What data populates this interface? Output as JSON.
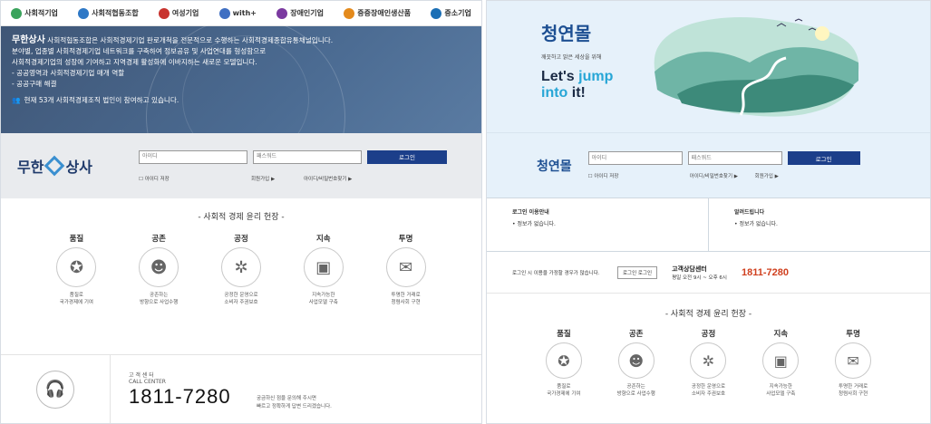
{
  "left": {
    "partners": [
      {
        "label": "사회적기업",
        "color": "#3aa35c"
      },
      {
        "label": "사회적협동조합",
        "color": "#2e78c6"
      },
      {
        "label": "여성기업",
        "color": "#c8332e"
      },
      {
        "label": "with+",
        "color": "#3f6fc2"
      },
      {
        "label": "장애인기업",
        "color": "#7b3aa0"
      },
      {
        "label": "중증장애인생산품",
        "color": "#e48a1c"
      },
      {
        "label": "중소기업",
        "color": "#1b6fb5"
      }
    ],
    "hero": {
      "title": "무한상사",
      "lines": [
        "사회적협동조합은 사회적경제기업 판로개척을 전문적으로 수행하는 사회적경제종합유통채널입니다.",
        "분야별, 업종별 사회적경제기업 네트워크를 구축하여 정보공유 및 사업연대를 형성함으로",
        "사회적경제기업의 성장에 기여하고 지역경제 활성화에 이바지하는 새로운 모델입니다.",
        "- 공공영역과 사회적경제기업 매개 역할",
        "- 공공구매 해결"
      ],
      "notice": "현재 53개 사회적경제조직 법인이 참여하고 있습니다."
    },
    "login": {
      "brand_a": "무한",
      "brand_b": "상사",
      "id_placeholder": "아이디",
      "pw_placeholder": "패스워드",
      "button": "로그인",
      "remember": "아이디 저장",
      "join": "회원가입 ▶",
      "find": "아이디/비밀번호찾기 ▶"
    },
    "ethics_title": "- 사회적 경제 윤리 헌장 -",
    "ethics": [
      {
        "name": "품질",
        "desc1": "품질로",
        "desc2": "국가경제에 기여",
        "icon": "medal-icon",
        "glyph": "✪"
      },
      {
        "name": "공존",
        "desc1": "공존하는",
        "desc2": "방향으로 사업수행",
        "icon": "people-icon",
        "glyph": "☻"
      },
      {
        "name": "공정",
        "desc1": "공정한 운영으로",
        "desc2": "소비자 주권보호",
        "icon": "network-icon",
        "glyph": "✲"
      },
      {
        "name": "지속",
        "desc1": "지속가능한",
        "desc2": "사업모델 구축",
        "icon": "box-icon",
        "glyph": "▣"
      },
      {
        "name": "투명",
        "desc1": "투명한 거래로",
        "desc2": "청렴사회 구현",
        "icon": "chat-icon",
        "glyph": "✉"
      }
    ],
    "call": {
      "label_ko": "고 객 센 터",
      "label_en": "CALL CENTER",
      "number": "1811-7280",
      "note1": "궁금하신 점을 문의해 주시면",
      "note2": "빠르고 정확하게 답변 드리겠습니다."
    }
  },
  "right": {
    "logo": "청연몰",
    "sub": "깨끗하고 맑은 세상을 위해",
    "slogan_a": "Let's ",
    "slogan_b": "jump",
    "slogan_c": "into",
    "slogan_d": " it!",
    "login": {
      "logo": "청연몰",
      "id_placeholder": "아이디",
      "pw_placeholder": "패스워드",
      "button": "로그인",
      "remember": "아이디 저장",
      "find": "아이디/비밀번호찾기 ▶",
      "join": "회원가입 ▶"
    },
    "info": [
      {
        "title": "로그인 이용안내",
        "item": "• 정보가 없습니다."
      },
      {
        "title": "알려드립니다",
        "item": "• 정보가 없습니다."
      }
    ],
    "call": {
      "note": "로그인 시 이용을 가정할 경우가 많습니다.",
      "btn": "로그인 로그인",
      "title": "고객상담센터",
      "hours": "평일 오전 9시 ~ 오후 6시",
      "number": "1811-7280"
    },
    "ethics_title": "- 사회적 경제 윤리 헌장 -"
  }
}
